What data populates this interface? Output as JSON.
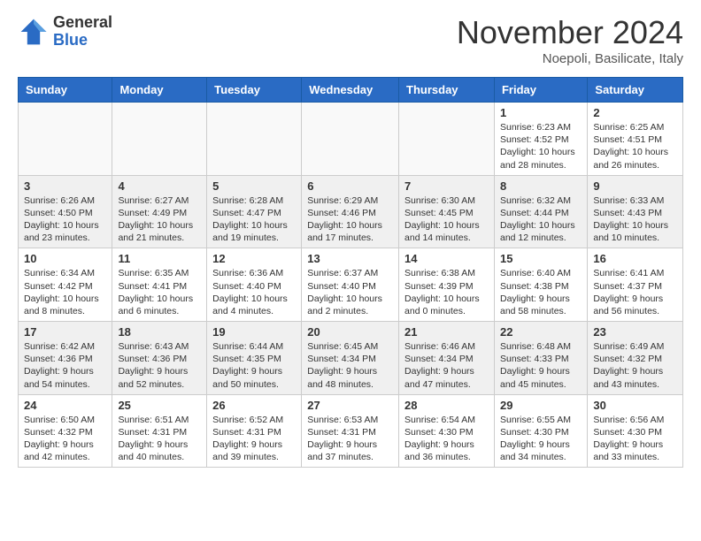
{
  "header": {
    "logo_general": "General",
    "logo_blue": "Blue",
    "month_title": "November 2024",
    "location": "Noepoli, Basilicate, Italy"
  },
  "weekdays": [
    "Sunday",
    "Monday",
    "Tuesday",
    "Wednesday",
    "Thursday",
    "Friday",
    "Saturday"
  ],
  "rows": [
    {
      "cells": [
        {
          "day": "",
          "info": ""
        },
        {
          "day": "",
          "info": ""
        },
        {
          "day": "",
          "info": ""
        },
        {
          "day": "",
          "info": ""
        },
        {
          "day": "",
          "info": ""
        },
        {
          "day": "1",
          "info": "Sunrise: 6:23 AM\nSunset: 4:52 PM\nDaylight: 10 hours\nand 28 minutes."
        },
        {
          "day": "2",
          "info": "Sunrise: 6:25 AM\nSunset: 4:51 PM\nDaylight: 10 hours\nand 26 minutes."
        }
      ]
    },
    {
      "cells": [
        {
          "day": "3",
          "info": "Sunrise: 6:26 AM\nSunset: 4:50 PM\nDaylight: 10 hours\nand 23 minutes."
        },
        {
          "day": "4",
          "info": "Sunrise: 6:27 AM\nSunset: 4:49 PM\nDaylight: 10 hours\nand 21 minutes."
        },
        {
          "day": "5",
          "info": "Sunrise: 6:28 AM\nSunset: 4:47 PM\nDaylight: 10 hours\nand 19 minutes."
        },
        {
          "day": "6",
          "info": "Sunrise: 6:29 AM\nSunset: 4:46 PM\nDaylight: 10 hours\nand 17 minutes."
        },
        {
          "day": "7",
          "info": "Sunrise: 6:30 AM\nSunset: 4:45 PM\nDaylight: 10 hours\nand 14 minutes."
        },
        {
          "day": "8",
          "info": "Sunrise: 6:32 AM\nSunset: 4:44 PM\nDaylight: 10 hours\nand 12 minutes."
        },
        {
          "day": "9",
          "info": "Sunrise: 6:33 AM\nSunset: 4:43 PM\nDaylight: 10 hours\nand 10 minutes."
        }
      ]
    },
    {
      "cells": [
        {
          "day": "10",
          "info": "Sunrise: 6:34 AM\nSunset: 4:42 PM\nDaylight: 10 hours\nand 8 minutes."
        },
        {
          "day": "11",
          "info": "Sunrise: 6:35 AM\nSunset: 4:41 PM\nDaylight: 10 hours\nand 6 minutes."
        },
        {
          "day": "12",
          "info": "Sunrise: 6:36 AM\nSunset: 4:40 PM\nDaylight: 10 hours\nand 4 minutes."
        },
        {
          "day": "13",
          "info": "Sunrise: 6:37 AM\nSunset: 4:40 PM\nDaylight: 10 hours\nand 2 minutes."
        },
        {
          "day": "14",
          "info": "Sunrise: 6:38 AM\nSunset: 4:39 PM\nDaylight: 10 hours\nand 0 minutes."
        },
        {
          "day": "15",
          "info": "Sunrise: 6:40 AM\nSunset: 4:38 PM\nDaylight: 9 hours\nand 58 minutes."
        },
        {
          "day": "16",
          "info": "Sunrise: 6:41 AM\nSunset: 4:37 PM\nDaylight: 9 hours\nand 56 minutes."
        }
      ]
    },
    {
      "cells": [
        {
          "day": "17",
          "info": "Sunrise: 6:42 AM\nSunset: 4:36 PM\nDaylight: 9 hours\nand 54 minutes."
        },
        {
          "day": "18",
          "info": "Sunrise: 6:43 AM\nSunset: 4:36 PM\nDaylight: 9 hours\nand 52 minutes."
        },
        {
          "day": "19",
          "info": "Sunrise: 6:44 AM\nSunset: 4:35 PM\nDaylight: 9 hours\nand 50 minutes."
        },
        {
          "day": "20",
          "info": "Sunrise: 6:45 AM\nSunset: 4:34 PM\nDaylight: 9 hours\nand 48 minutes."
        },
        {
          "day": "21",
          "info": "Sunrise: 6:46 AM\nSunset: 4:34 PM\nDaylight: 9 hours\nand 47 minutes."
        },
        {
          "day": "22",
          "info": "Sunrise: 6:48 AM\nSunset: 4:33 PM\nDaylight: 9 hours\nand 45 minutes."
        },
        {
          "day": "23",
          "info": "Sunrise: 6:49 AM\nSunset: 4:32 PM\nDaylight: 9 hours\nand 43 minutes."
        }
      ]
    },
    {
      "cells": [
        {
          "day": "24",
          "info": "Sunrise: 6:50 AM\nSunset: 4:32 PM\nDaylight: 9 hours\nand 42 minutes."
        },
        {
          "day": "25",
          "info": "Sunrise: 6:51 AM\nSunset: 4:31 PM\nDaylight: 9 hours\nand 40 minutes."
        },
        {
          "day": "26",
          "info": "Sunrise: 6:52 AM\nSunset: 4:31 PM\nDaylight: 9 hours\nand 39 minutes."
        },
        {
          "day": "27",
          "info": "Sunrise: 6:53 AM\nSunset: 4:31 PM\nDaylight: 9 hours\nand 37 minutes."
        },
        {
          "day": "28",
          "info": "Sunrise: 6:54 AM\nSunset: 4:30 PM\nDaylight: 9 hours\nand 36 minutes."
        },
        {
          "day": "29",
          "info": "Sunrise: 6:55 AM\nSunset: 4:30 PM\nDaylight: 9 hours\nand 34 minutes."
        },
        {
          "day": "30",
          "info": "Sunrise: 6:56 AM\nSunset: 4:30 PM\nDaylight: 9 hours\nand 33 minutes."
        }
      ]
    }
  ]
}
